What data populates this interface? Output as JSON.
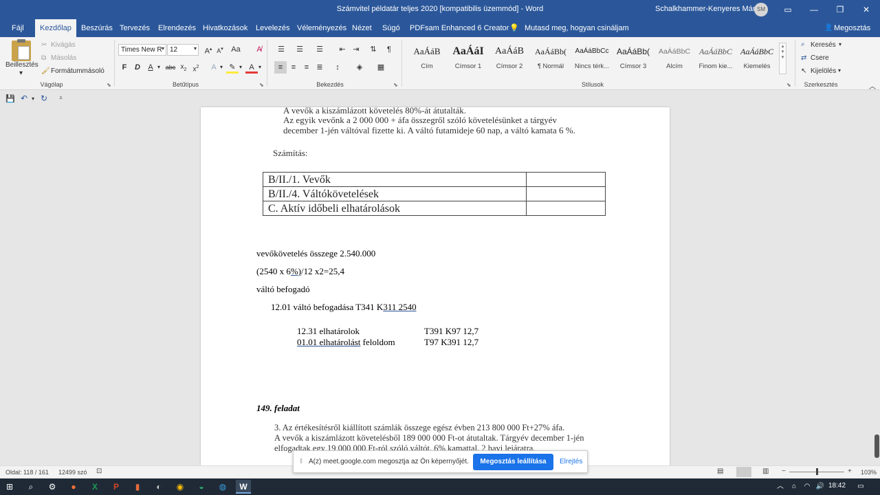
{
  "titlebar": {
    "title": "Számvitel példatár teljes 2020 [kompatibilis üzemmód]  -  Word",
    "user": "Schalkhammer-Kenyeres Márta",
    "avatar": "SM"
  },
  "tabs": [
    "Fájl",
    "Kezdőlap",
    "Beszúrás",
    "Tervezés",
    "Elrendezés",
    "Hivatkozások",
    "Levelezés",
    "Véleményezés",
    "Nézet",
    "Súgó",
    "PDFsam Enhanced 6 Creator"
  ],
  "tell_me": "Mutasd meg, hogyan csináljam",
  "share": "Megosztás",
  "clipboard": {
    "paste": "Beillesztés",
    "cut": "Kivágás",
    "copy": "Másolás",
    "format_painter": "Formátummásoló",
    "label": "Vágólap"
  },
  "font": {
    "name": "Times New R",
    "size": "12",
    "bold": "F",
    "italic": "D",
    "underline": "A",
    "label": "Betűtípus"
  },
  "paragraph": {
    "label": "Bekezdés"
  },
  "styles": {
    "items": [
      {
        "preview": "AaÁáB",
        "name": "Cím"
      },
      {
        "preview": "AaÁáI",
        "name": "Címsor 1"
      },
      {
        "preview": "AaÁáB",
        "name": "Címsor 2"
      },
      {
        "preview": "AaÁáBb(",
        "name": "¶ Normál"
      },
      {
        "preview": "AaÁáBbCc",
        "name": "Nincs térk..."
      },
      {
        "preview": "AaÁáBb(",
        "name": "Címsor 3"
      },
      {
        "preview": "AaÁáBbC",
        "name": "Alcím"
      },
      {
        "preview": "AaÁáBbC",
        "name": "Finom kie..."
      },
      {
        "preview": "AaÁáBbC",
        "name": "Kiemelés"
      }
    ],
    "label": "Stílusok"
  },
  "editing": {
    "find": "Keresés",
    "replace": "Csere",
    "select": "Kijelölés",
    "label": "Szerkesztés"
  },
  "document": {
    "scan_line1": "A vevők a kiszámlázott követelés 80%-át átutalták.",
    "scan_line2": "Az egyik vevőnk a 2 000 000 + áfa összegről szóló követelésünket a tárgyév",
    "scan_line3": "december 1-jén váltóval fizette ki. A váltó futamideje 60 nap, a váltó kamata 6 %.",
    "calc_label": "Számítás:",
    "table_rows": [
      "B/II./1. Vevők",
      "B/II./4. Váltókövetelések",
      "C. Aktív időbeli elhatárolások"
    ],
    "line_receivable": "vevőkövetelés összege 2.540.000",
    "line_calc_a": "(2540 x 6",
    "line_calc_b": "%)",
    "line_calc_c": "/12 x2=25,4",
    "line_acceptor": "váltó befogadó",
    "line_1201_a": "12.01  váltó befogadása T341 K",
    "line_1201_b": "311  2540",
    "line_1231_left": "12.31 elhatárolok",
    "line_1231_right": "T391 K97   12,7",
    "line_0101_a": "01.01  elhatárolást",
    "line_0101_b": " feloldom",
    "line_0101_right": "T97  K391  12,7",
    "task_title": "149. feladat",
    "task_line1": "3.  Az  értékesítésről  kiállított  számlák  összege  egész  évben  213  800 000  Ft+27%  áfa.",
    "task_line2": "A vevők a kiszámlázott követelésből 189 000 000 Ft-ot átutaltak. Tárgyév december 1-jén",
    "task_line3": "elfogadtak egy 19 000 000 Ft-ról szóló váltót, 6% kamattal, 2 havi lejáratra."
  },
  "status": {
    "page": "Oldal: 118 / 161",
    "words": "12499 szó",
    "zoom": "103%"
  },
  "sharebar": {
    "message": "A(z) meet.google.com megosztja az Ön képernyőjét.",
    "stop": "Megosztás leállítása",
    "hide": "Elrejtés"
  },
  "taskbar": {
    "time": "18:42"
  }
}
